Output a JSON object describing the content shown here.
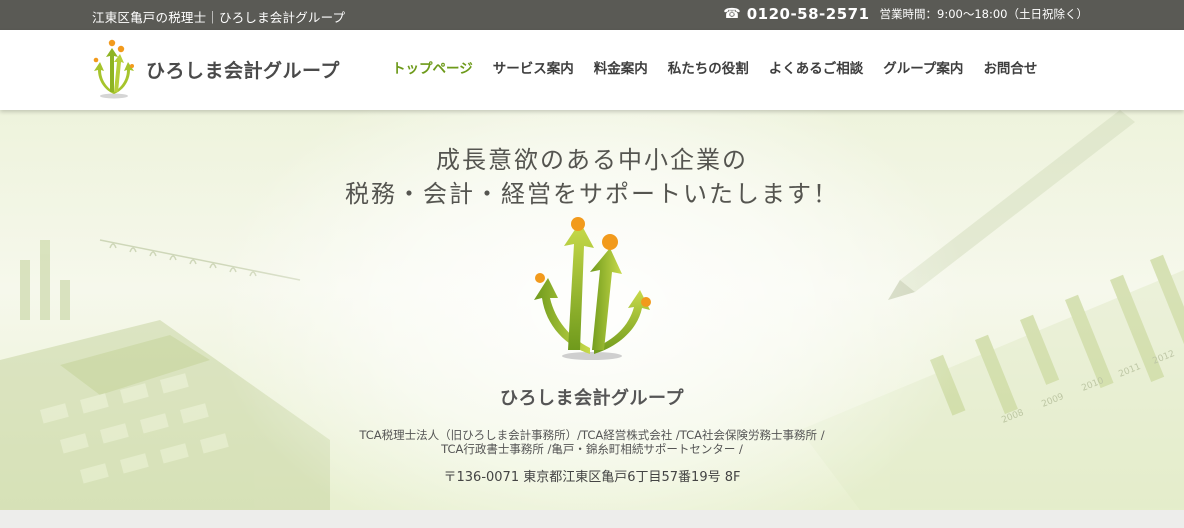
{
  "topbar": {
    "tagline": "江東区亀戸の税理士｜ひろしま会計グループ",
    "phone_icon": "phone-icon",
    "phone": "0120-58-2571",
    "hours": "営業時間：9:00〜18:00（土日祝除く）"
  },
  "header": {
    "logo_icon": "sprout-arrows-logo-icon",
    "brand_name": "ひろしま会計グループ",
    "nav": [
      {
        "label": "トップページ",
        "active": true
      },
      {
        "label": "サービス案内"
      },
      {
        "label": "料金案内"
      },
      {
        "label": "私たちの役割"
      },
      {
        "label": "よくあるご相談"
      },
      {
        "label": "グループ案内"
      },
      {
        "label": "お問合せ"
      }
    ]
  },
  "hero": {
    "headline_1": "成長意欲のある中小企業の",
    "headline_2": "税務・会計・経営をサポートいたします！",
    "brand_name": "ひろしま会計グループ",
    "offices_line_1": "TCA税理士法人（旧ひろしま会計事務所）/TCA経営株式会社 /TCA社会保険労務士事務所 /",
    "offices_line_2": "TCA行政書士事務所 /亀戸・錦糸町相続サポートセンター /",
    "address": "〒136-0071 東京都江東区亀戸6丁目57番19号 8F",
    "bg_year_labels": [
      "2008",
      "2009",
      "2010",
      "2011",
      "2012"
    ]
  },
  "colors": {
    "topbar_bg": "#5a5a55",
    "accent_green": "#6d9a1a",
    "logo_orange": "#f29a1c"
  }
}
